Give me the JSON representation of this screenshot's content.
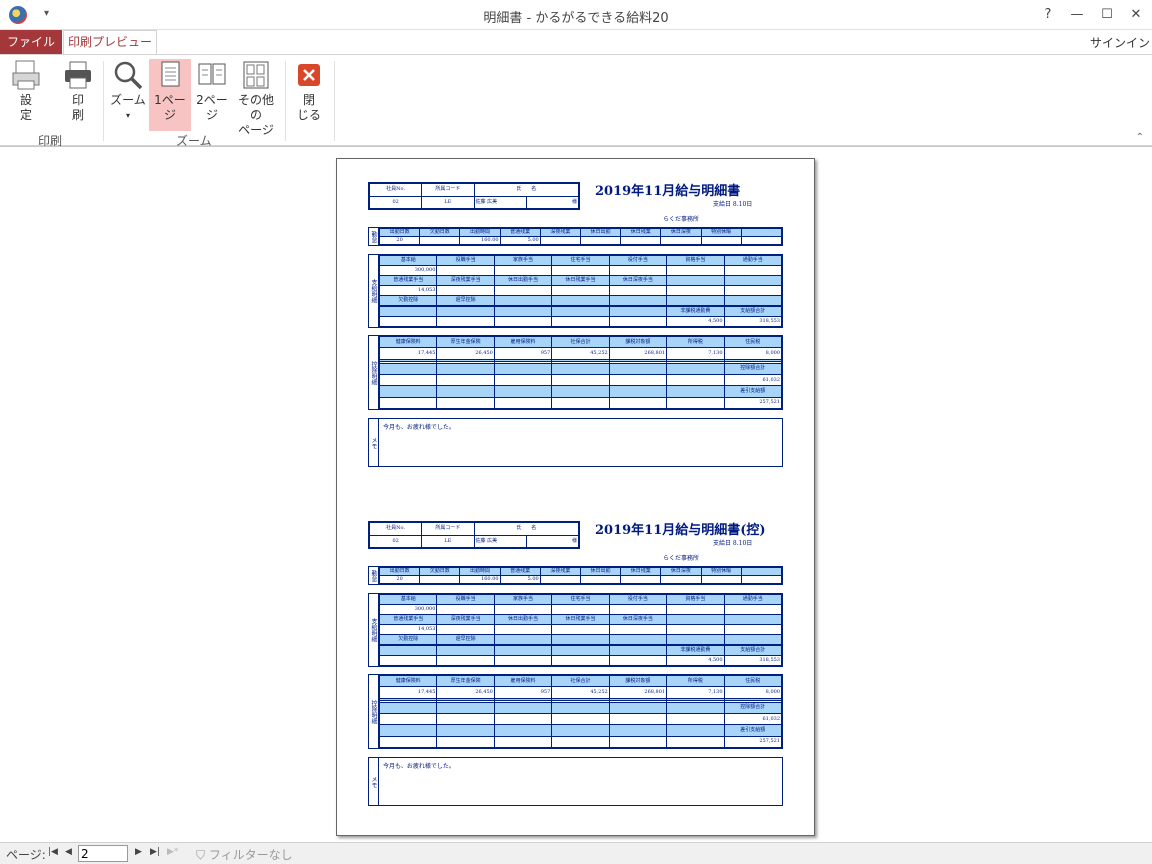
{
  "window": {
    "title": "明細書 - かるがるできる給料20",
    "help": "?",
    "minimize": "—",
    "maximize": "☐",
    "close": "✕"
  },
  "tabs": {
    "file": "ファイル",
    "print_preview": "印刷プレビュー",
    "signin": "サインイン"
  },
  "ribbon": {
    "setup": "設\n定",
    "print": "印\n刷",
    "zoom": "ズーム",
    "one_page": "1ペー\nジ",
    "two_page": "2ペー\nジ",
    "other_pages": "その他の\nページ",
    "close": "閉\nじる",
    "group_print": "印刷",
    "group_zoom": "ズーム",
    "active_item": "1ページ"
  },
  "slip": {
    "title1": "2019年11月給与明細書",
    "title2": "2019年11月給与明細書(控)",
    "pay_date": "支給日 8.10日",
    "company": "らくだ事務所",
    "header_cols": [
      "社員No.",
      "所属コード",
      "氏　　名"
    ],
    "header_vals": [
      "02",
      "LE",
      "佐藤 広美",
      "様"
    ],
    "attend_label": "勤怠",
    "attend_cols": [
      "出勤日数",
      "欠勤日数",
      "出勤時間",
      "普通残業",
      "深夜残業",
      "休日出勤",
      "休日残業",
      "休日深夜",
      "特別休暇"
    ],
    "attend_vals": [
      "20",
      "",
      "160.00",
      "5.00",
      "",
      "",
      "",
      "",
      ""
    ],
    "pay_label": "支給明細",
    "pay_cols1": [
      "基本給",
      "役職手当",
      "家族手当",
      "住宅手当",
      "役付手当",
      "資格手当",
      "通勤手当"
    ],
    "pay_vals1": [
      "300,000",
      "",
      "",
      "",
      "",
      "",
      ""
    ],
    "pay_cols2": [
      "普通残業手当",
      "深夜残業手当",
      "休日出勤手当",
      "休日残業手当",
      "休日深夜手当",
      "",
      ""
    ],
    "pay_vals2": [
      "14,053",
      "",
      "",
      "",
      "",
      "",
      ""
    ],
    "pay_cols3": [
      "欠勤控除",
      "遅早控除",
      "",
      "",
      "",
      "",
      ""
    ],
    "pay_total_labels": [
      "非課税通勤費",
      "支給額合計"
    ],
    "pay_total_vals": [
      "4,500",
      "318,553"
    ],
    "ded_label": "控除明細",
    "ded_cols": [
      "健康保険料",
      "厚生年金保険",
      "雇用保険料",
      "社保合計",
      "課税対象額",
      "所得税",
      "住民税"
    ],
    "ded_vals": [
      "17,445",
      "26,450",
      "957",
      "45,252",
      "268,801",
      "7,130",
      "8,000"
    ],
    "ded_total_label": "控除額合計",
    "ded_total": "61,032",
    "net_label": "差引支給額",
    "net": "257,521",
    "memo_label": "メモ",
    "memo": "今月も、お疲れ様でした。"
  },
  "status": {
    "page_label": "ページ:",
    "page_value": "2",
    "filter": "フィルターなし"
  }
}
